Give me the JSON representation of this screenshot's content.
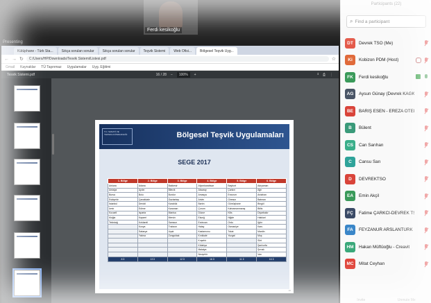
{
  "meeting": {
    "video_name": "Ferdi kesikoğlu",
    "presenter_label": "Presenting"
  },
  "browser": {
    "tabs": [
      "Kütüphane - Türk Sta...",
      "Sıkça sorulan sorular",
      "Sıkça sorulan sorular",
      "Teşvik Sistemi",
      "Web Ofisi...",
      "Bölgesel Teşvik Uyg..."
    ],
    "address": "C:/Users/HP/Downloads/Tesvik Sistemi/Listesi.pdf",
    "bookmarks": [
      "Gmail",
      "Kaynaklar",
      "TÜ Taşınmaz",
      "Uygulamalar",
      "Uyg. Eğitimi"
    ]
  },
  "pdf": {
    "filename": "Tesvik Sistemi.pdf",
    "page_indicator": "16 / 28",
    "zoom": "100%",
    "minus": "−",
    "plus": "+"
  },
  "slide": {
    "logo_text": "T.C. SANAYİ VE TEKNOLOJİ BAKANLIĞI",
    "title": "Bölgesel Teşvik Uygulamaları",
    "subtitle": "SEGE 2017",
    "columns": [
      "1. Bölge",
      "2. Bölge",
      "3. Bölge",
      "4. Bölge",
      "5. Bölge",
      "6. Bölge"
    ],
    "rows": [
      [
        "Ankara",
        "Adana",
        "Balıkesir",
        "Afyonkarahisar",
        "Bayburt",
        "Adıyaman"
      ],
      [
        "Antalya",
        "Aydın",
        "Bilecik",
        "Aksaray",
        "Çankırı",
        "Ağrı"
      ],
      [
        "Bursa",
        "Bolu",
        "Burdur",
        "Amasya",
        "Erzurum",
        "Ardahan"
      ],
      [
        "Eskişehir",
        "Çanakkale",
        "Gaziantep",
        "Artvin",
        "Giresun",
        "Batman"
      ],
      [
        "İstanbul",
        "Denizli",
        "Karabük",
        "Bartın",
        "Gümüşhane",
        "Bingöl"
      ],
      [
        "İzmir",
        "Edirne",
        "Karaman",
        "Çorum",
        "Kahramanmaraş",
        "Bitlis"
      ],
      [
        "Kocaeli",
        "Isparta",
        "Manisa",
        "Düzce",
        "Kilis",
        "Diyarbakır"
      ],
      [
        "Muğla",
        "Kayseri",
        "Mersin",
        "Elazığ",
        "Niğde",
        "Hakkari"
      ],
      [
        "Tekirdağ",
        "Kırklareli",
        "Samsun",
        "Erzincan",
        "Ordu",
        "Iğdır"
      ],
      [
        "",
        "Konya",
        "Trabzon",
        "Hatay",
        "Osmaniye",
        "Kars"
      ],
      [
        "",
        "Sakarya",
        "Uşak",
        "Kastamonu",
        "Tokat",
        "Mardin"
      ],
      [
        "",
        "Yalova",
        "Zonguldak",
        "Kırıkkale",
        "Yozgat",
        "Muş"
      ],
      [
        "",
        "",
        "",
        "Kırşehir",
        "",
        "Siirt"
      ],
      [
        "",
        "",
        "",
        "Kütahya",
        "",
        "Şanlıurfa"
      ],
      [
        "",
        "",
        "",
        "Malatya",
        "",
        "Şırnak"
      ],
      [
        "",
        "",
        "",
        "Nevşehir",
        "",
        "Van"
      ]
    ],
    "footer": [
      "8 İl",
      "13 İl",
      "12 İl",
      "16 İl",
      "11 İl",
      "16 İl"
    ]
  },
  "participants_panel": {
    "header": "Participants (22)",
    "search_placeholder": "Find a participant",
    "footer": [
      "Invite",
      "Unmute Me"
    ],
    "items": [
      {
        "initials": "DT",
        "name": "Devrek TSO (Me)",
        "color": "#e45a4a",
        "muted": true
      },
      {
        "initials": "Ki",
        "name": "Kobizon PDM (Host)",
        "color": "#e06a3a",
        "muted": true
      },
      {
        "initials": "FK",
        "name": "Ferdi kesikoğlu",
        "color": "#3a9a5a",
        "muted": false
      },
      {
        "initials": "AG",
        "name": "Aysun Günay (Devrek KAGK)",
        "color": "#4a5566",
        "muted": true
      },
      {
        "initials": "BE",
        "name": "BARIŞ ESEN - EREZA OTEL",
        "color": "#d9443a",
        "muted": true
      },
      {
        "initials": "B",
        "name": "Bülent",
        "color": "#3a9a7a",
        "muted": true
      },
      {
        "initials": "CS",
        "name": "Can Sarıhan",
        "color": "#3aae8a",
        "muted": true
      },
      {
        "initials": "C",
        "name": "Cansu Sarı",
        "color": "#2fa39a",
        "muted": true
      },
      {
        "initials": "D",
        "name": "DEVREKTSO",
        "color": "#d9443a",
        "muted": true
      },
      {
        "initials": "EA",
        "name": "Emin Akçil",
        "color": "#3a9a5a",
        "muted": true
      },
      {
        "initials": "FÇ",
        "name": "Fatime ÇARKCI-DEVREK TSO",
        "color": "#3a4a66",
        "muted": true
      },
      {
        "initials": "FA",
        "name": "FEYZANUR ARSLANTÜRK",
        "color": "#3a86c8",
        "muted": true
      },
      {
        "initials": "HM",
        "name": "Hakan Müftüoğlu - Creavit",
        "color": "#3aa87a",
        "muted": true
      },
      {
        "initials": "MC",
        "name": "Mitat Ceyhan",
        "color": "#e0443a",
        "muted": true
      }
    ]
  }
}
